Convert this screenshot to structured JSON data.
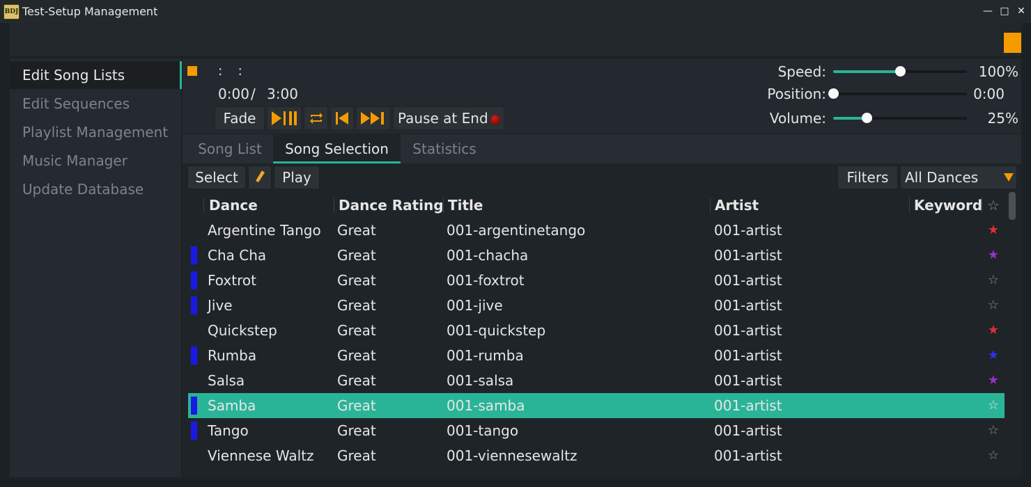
{
  "window": {
    "title": "Test-Setup Management",
    "icon_text": "BDJ"
  },
  "colors": {
    "accent": "#2ab497",
    "orange": "#f59b00",
    "marker_blue": "#1919e6",
    "star_red": "#e03030",
    "star_purple": "#9a30c8",
    "star_blue": "#3030f0",
    "star_empty": "#8a8f94"
  },
  "sidebar": {
    "items": [
      {
        "label": "Edit Song Lists",
        "active": true
      },
      {
        "label": "Edit Sequences",
        "active": false
      },
      {
        "label": "Playlist Management",
        "active": false
      },
      {
        "label": "Music Manager",
        "active": false
      },
      {
        "label": "Update Database",
        "active": false
      }
    ]
  },
  "player": {
    "meta": ": :",
    "time_current": "0:00",
    "time_sep": "/",
    "time_total": "3:00",
    "buttons": {
      "fade": "Fade",
      "pause_at_end": "Pause at End"
    },
    "icons": {
      "play_pause": "play-pause-icon",
      "repeat": "repeat-icon",
      "prev": "skip-back-icon",
      "next": "skip-forward-icon",
      "indicator": "record-indicator-icon"
    },
    "speed": {
      "label": "Speed:",
      "value": "100%",
      "level": 0.5
    },
    "position": {
      "label": "Position:",
      "value": "0:00",
      "level": 0.0
    },
    "volume": {
      "label": "Volume:",
      "value": "25%",
      "level": 0.25
    }
  },
  "tabs": [
    {
      "label": "Song List",
      "active": false
    },
    {
      "label": "Song Selection",
      "active": true
    },
    {
      "label": "Statistics",
      "active": false
    }
  ],
  "actions": {
    "select": "Select",
    "play": "Play",
    "filters": "Filters",
    "dance_filter": "All Dances"
  },
  "table": {
    "headers": {
      "dance": "Dance",
      "rating": "Dance Rating",
      "title": "Title",
      "artist": "Artist",
      "keyword": "Keyword",
      "favorite": "☆"
    },
    "rows": [
      {
        "marker": false,
        "dance": "Argentine Tango",
        "rating": "Great",
        "title": "001-argentinetango",
        "artist": "001-artist",
        "star": "★",
        "star_color": "#e03030",
        "selected": false
      },
      {
        "marker": true,
        "dance": "Cha Cha",
        "rating": "Great",
        "title": "001-chacha",
        "artist": "001-artist",
        "star": "★",
        "star_color": "#9a30c8",
        "selected": false
      },
      {
        "marker": true,
        "dance": "Foxtrot",
        "rating": "Great",
        "title": "001-foxtrot",
        "artist": "001-artist",
        "star": "☆",
        "star_color": "#8a8f94",
        "selected": false
      },
      {
        "marker": true,
        "dance": "Jive",
        "rating": "Great",
        "title": "001-jive",
        "artist": "001-artist",
        "star": "☆",
        "star_color": "#8a8f94",
        "selected": false
      },
      {
        "marker": false,
        "dance": "Quickstep",
        "rating": "Great",
        "title": "001-quickstep",
        "artist": "001-artist",
        "star": "★",
        "star_color": "#e03030",
        "selected": false
      },
      {
        "marker": true,
        "dance": "Rumba",
        "rating": "Great",
        "title": "001-rumba",
        "artist": "001-artist",
        "star": "★",
        "star_color": "#3030f0",
        "selected": false
      },
      {
        "marker": false,
        "dance": "Salsa",
        "rating": "Great",
        "title": "001-salsa",
        "artist": "001-artist",
        "star": "★",
        "star_color": "#9a30c8",
        "selected": false
      },
      {
        "marker": true,
        "dance": "Samba",
        "rating": "Great",
        "title": "001-samba",
        "artist": "001-artist",
        "star": "☆",
        "star_color": "#e6e6e6",
        "selected": true
      },
      {
        "marker": true,
        "dance": "Tango",
        "rating": "Great",
        "title": "001-tango",
        "artist": "001-artist",
        "star": "☆",
        "star_color": "#8a8f94",
        "selected": false
      },
      {
        "marker": false,
        "dance": "Viennese Waltz",
        "rating": "Great",
        "title": "001-viennesewaltz",
        "artist": "001-artist",
        "star": "☆",
        "star_color": "#8a8f94",
        "selected": false
      }
    ]
  }
}
